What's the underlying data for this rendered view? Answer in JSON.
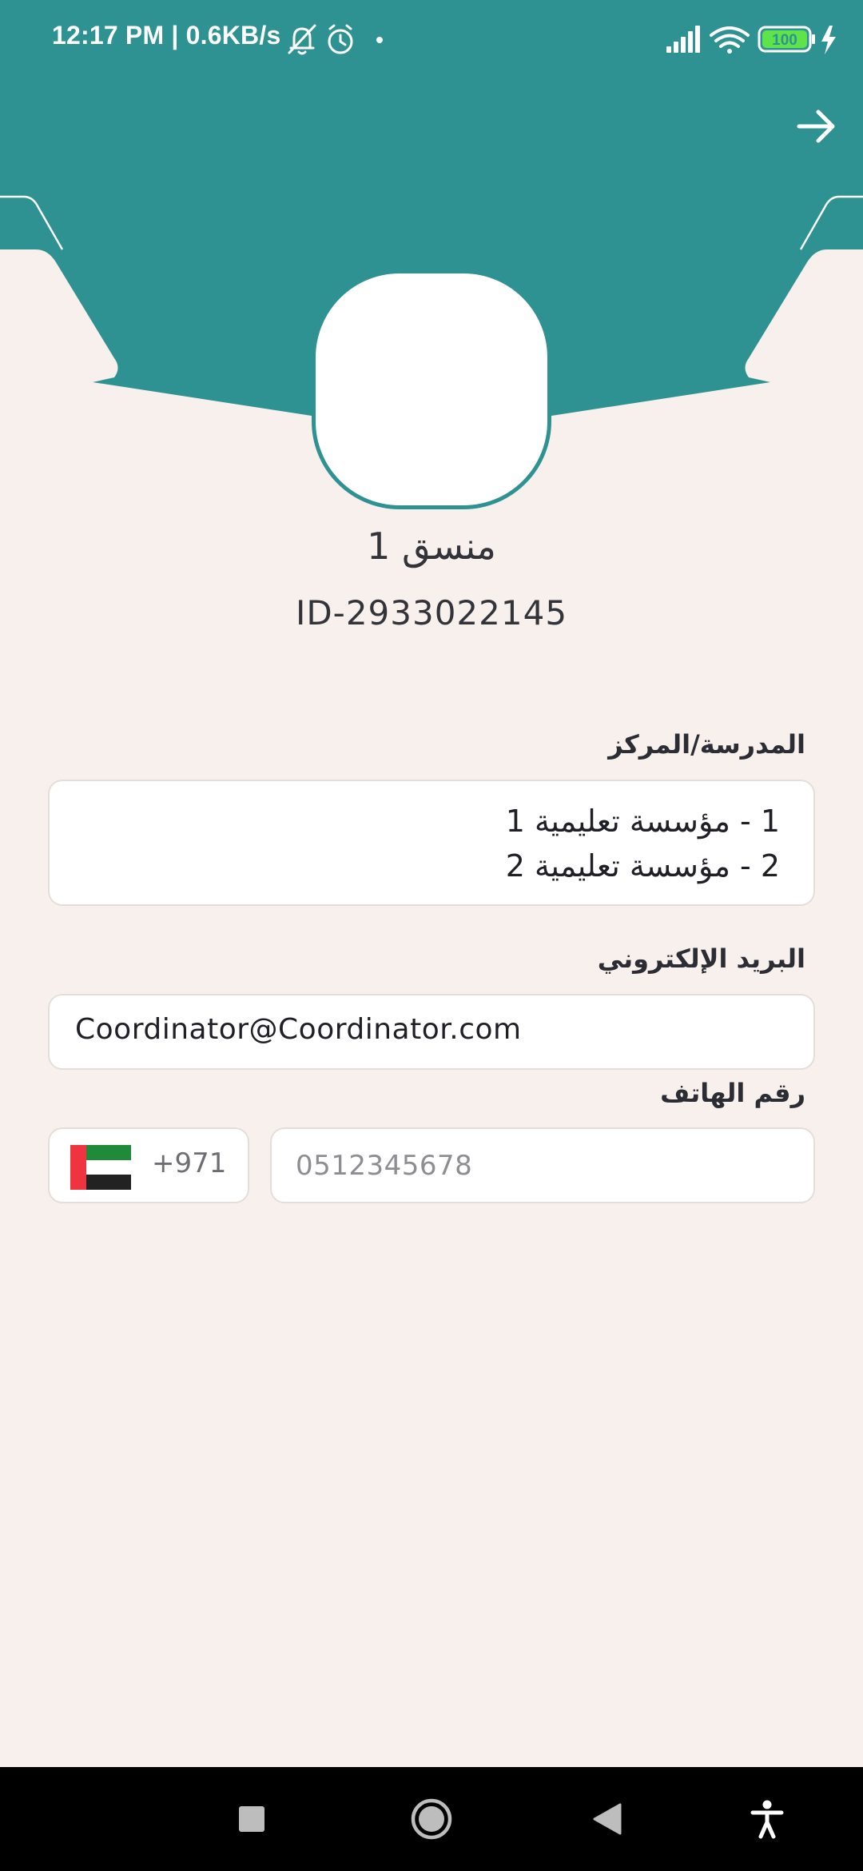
{
  "status_bar": {
    "time_speed": "12:17 PM | 0.6KB/s",
    "battery_level": "100",
    "icons": [
      "mute-bell-icon",
      "alarm-icon",
      "dot-icon",
      "signal-icon",
      "wifi-icon",
      "battery-icon",
      "charging-icon"
    ]
  },
  "header": {
    "back_icon": "arrow-right-icon"
  },
  "profile": {
    "name": "منسق 1",
    "id": "ID-2933022145"
  },
  "school": {
    "label": "المدرسة/المركز",
    "lines": [
      "1 - مؤسسة تعليمية 1",
      "2 - مؤسسة تعليمية 2"
    ]
  },
  "email": {
    "label": "البريد الإلكتروني",
    "value": "Coordinator@Coordinator.com"
  },
  "phone": {
    "label": "رقم الهاتف",
    "country_code": "+971",
    "country_flag": "uae-flag-icon",
    "placeholder": "0512345678",
    "value": ""
  },
  "nav_bar": {
    "buttons": [
      "recents-icon",
      "home-icon",
      "back-icon",
      "accessibility-icon"
    ]
  },
  "colors": {
    "accent": "#2f9292",
    "background": "#f8f0ec"
  }
}
